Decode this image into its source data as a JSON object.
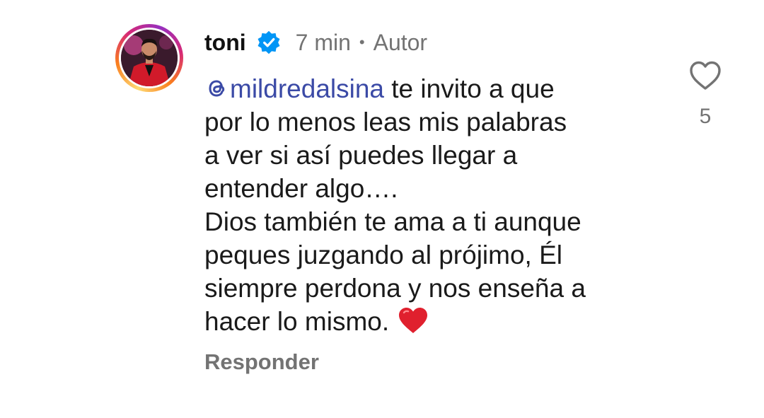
{
  "comment": {
    "username": "toni",
    "time": "7 min",
    "separator": "•",
    "role": "Autor",
    "mention": "mildredalsina",
    "lines": {
      "l1": "te invito a que",
      "l2": "por lo menos leas mis palabras",
      "l3": "a ver si así puedes llegar a",
      "l4": "entender algo….",
      "l5": "Dios también te ama a ti aunque",
      "l6": "peques juzgando al prójimo, Él",
      "l7": "siempre perdona y nos enseña a",
      "l8": "hacer lo mismo."
    },
    "reply_label": "Responder",
    "like_count": "5"
  },
  "icons": {
    "verified": "verified-badge-icon",
    "threads": "threads-icon",
    "like": "heart-outline-icon",
    "emoji": "red-heart-emoji"
  },
  "colors": {
    "mention": "#3b4aa6",
    "verified": "#0095f6",
    "muted": "#737373"
  }
}
